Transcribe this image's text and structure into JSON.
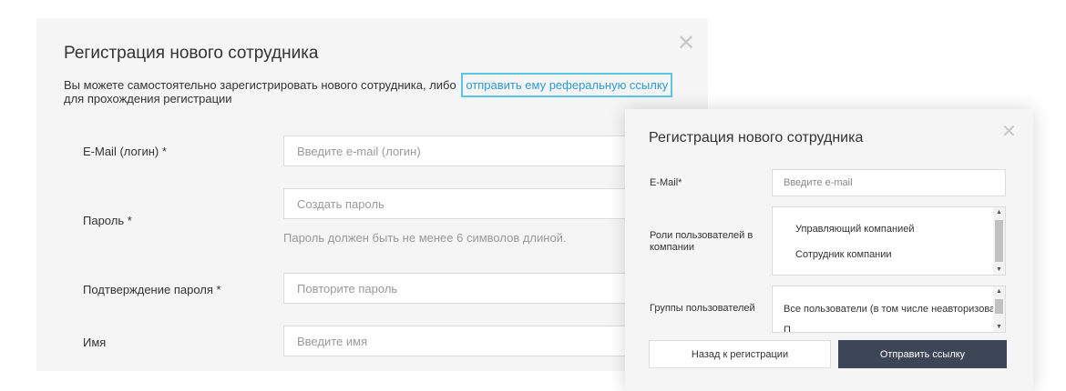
{
  "back_modal": {
    "title": "Регистрация нового сотрудника",
    "close_glyph": "✕",
    "description_text": "Вы можете самостоятельно зарегистрировать нового сотрудника, либо",
    "referral_link": "отправить ему реферальную ссылку",
    "description_tail": "для прохождения регистрации",
    "fields": {
      "email": {
        "label": "E-Mail (логин) *",
        "placeholder": "Введите e-mail (логин)",
        "value": ""
      },
      "password": {
        "label": "Пароль *",
        "placeholder": "Создать пароль",
        "hint": "Пароль должен быть не менее 6 символов длиной.",
        "value": ""
      },
      "password_confirm": {
        "label": "Подтверждение пароля *",
        "placeholder": "Повторите пароль",
        "value": ""
      },
      "name": {
        "label": "Имя",
        "placeholder": "Введите имя",
        "value": ""
      }
    },
    "colors": {
      "link": "#2a9bd6",
      "link_focus_border": "#5fc3e6"
    }
  },
  "front_modal": {
    "title": "Регистрация нового сотрудника",
    "close_glyph": "✕",
    "email": {
      "label": "E-Mail*",
      "placeholder": "Введите e-mail",
      "value": ""
    },
    "roles": {
      "label": "Роли пользователей в компании",
      "options": [
        "Управляющий компанией",
        "Сотрудник компании"
      ]
    },
    "groups": {
      "label": "Группы пользователей",
      "options": [
        "Все пользователи (в том числе неавторизованные)",
        "П"
      ]
    },
    "back_button": "Назад к регистрации",
    "send_button": "Отправить ссылку",
    "scroll_up_glyph": "▲",
    "scroll_down_glyph": "▼",
    "colors": {
      "primary_button": "#3d4657"
    }
  }
}
